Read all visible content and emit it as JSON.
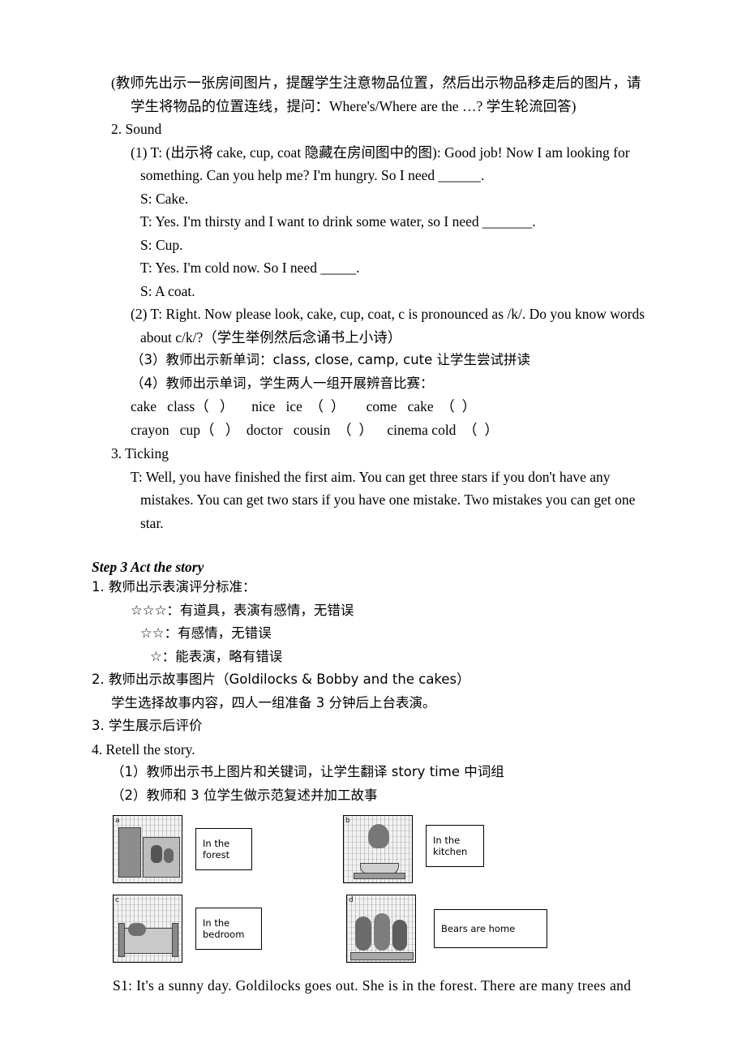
{
  "doc": {
    "lines": {
      "l1": "(教师先出示一张房间图片，提醒学生注意物品位置，然后出示物品移走后的图片，请",
      "l2": "学生将物品的位置连线，提问：Where's/Where are the …? 学生轮流回答)",
      "l3": "2. Sound",
      "l4": "(1) T: (出示将 cake, cup, coat 隐藏在房间图中的图): Good job! Now I am looking for",
      "l5": "something. Can you help me? I'm hungry. So I need ______.",
      "l6": "S: Cake.",
      "l7": "T: Yes. I'm thirsty and I want to drink some water, so I need _______.",
      "l8": "S: Cup.",
      "l9": "T: Yes. I'm cold now. So I need _____.",
      "l10": "S: A coat.",
      "l11": "(2) T: Right. Now please look, cake, cup, coat, c is pronounced as /k/. Do you know words",
      "l12": "about c/k/?（学生举例然后念诵书上小诗）",
      "l13": "（3）教师出示新单词：class, close, camp, cute 让学生尝试拼读",
      "l14": "（4）教师出示单词，学生两人一组开展辨音比赛：",
      "word_row_1": "cake   class（   ）     nice   ice  （  ）      come   cake  （  ）",
      "word_row_2": "crayon   cup（   ）  doctor   cousin  （  ）    cinema cold  （  ）",
      "l15": "3. Ticking",
      "l16": "T: Well, you have finished the first aim. You can get three stars if you don't have any",
      "l17": "mistakes. You can get two stars if you have one mistake. Two mistakes you can get one",
      "l18": "star.",
      "step3_title": "Step 3 Act the story",
      "l19": "1.  教师出示表演评分标准：",
      "l20": "☆☆☆：有道具，表演有感情，无错误",
      "l21": "☆☆：有感情，无错误",
      "l22": "☆：能表演，略有错误",
      "l23": "2. 教师出示故事图片（Goldilocks & Bobby and the cakes）",
      "l24": "学生选择故事内容，四人一组准备 3 分钟后上台表演。",
      "l25": "3. 学生展示后评价",
      "l26": "4. Retell the story.",
      "l27": "（1）教师出示书上图片和关键词，让学生翻译 story time  中词组",
      "l28": "（2）教师和 3 位学生做示范复述并加工故事",
      "final": "S1: It's a sunny day. Goldilocks goes out. She is in the forest. There are many trees and"
    },
    "picture_labels": {
      "p1": "In the forest",
      "p2": "In the kitchen",
      "p3": "In the bedroom",
      "p4": "Bears are home"
    },
    "picture_tags": {
      "a": "a",
      "b": "b",
      "c": "c",
      "d": "d"
    }
  }
}
